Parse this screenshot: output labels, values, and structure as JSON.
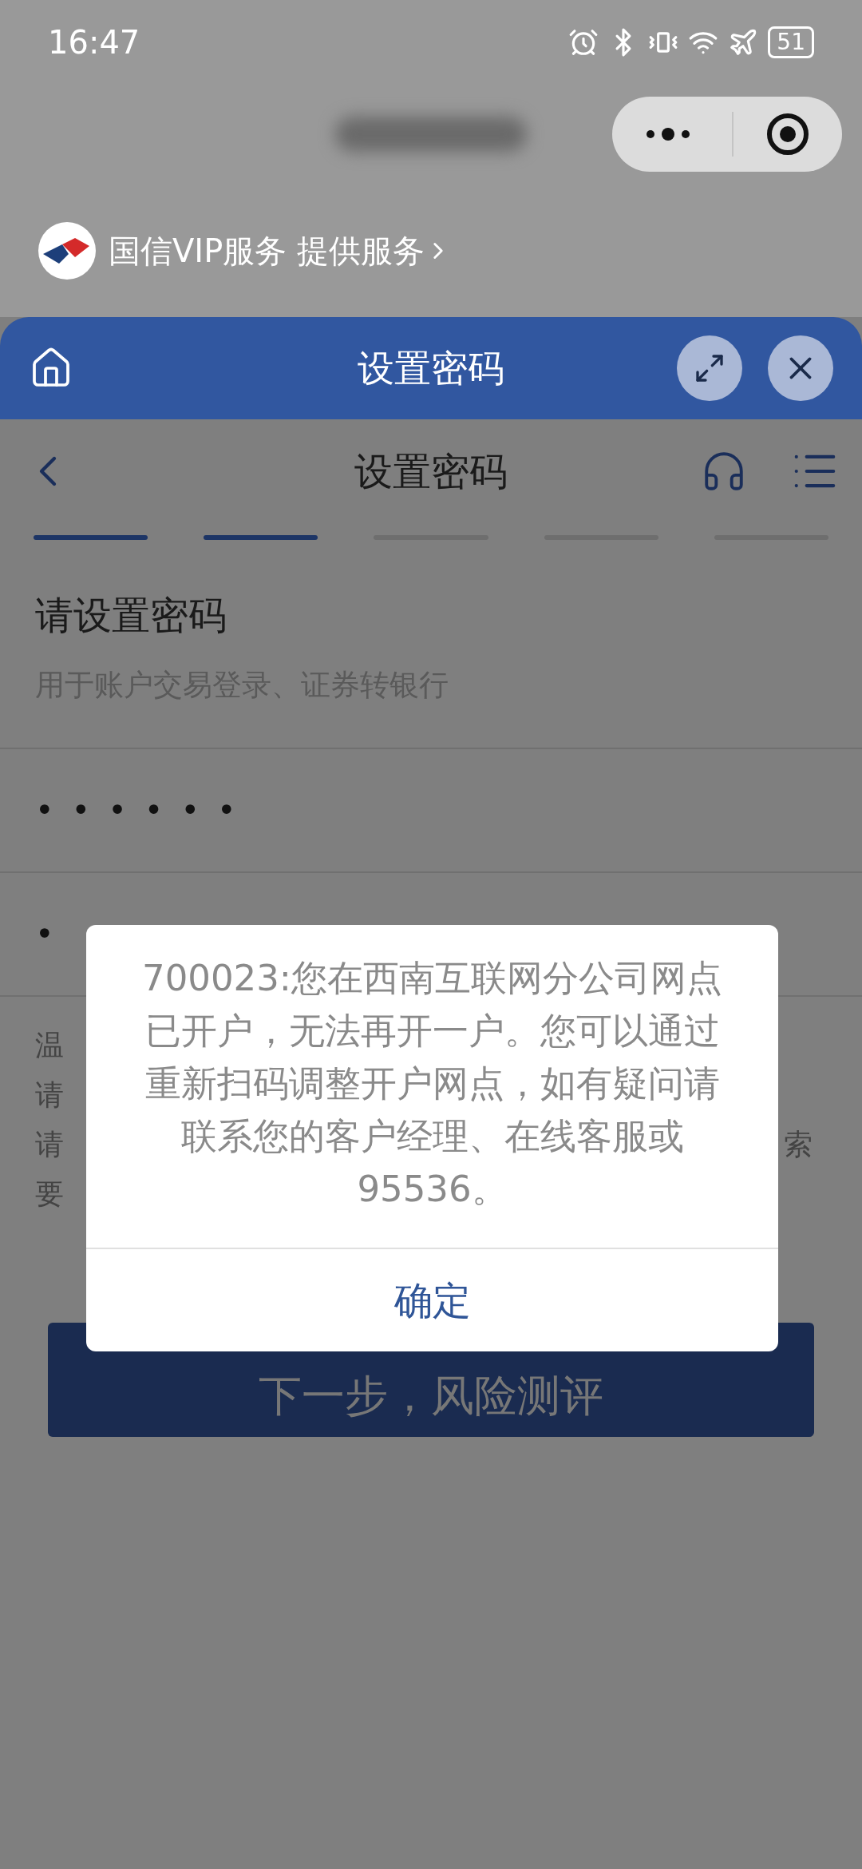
{
  "status_bar": {
    "time": "16:47",
    "battery": "51"
  },
  "provider": {
    "label": "国信VIP服务 提供服务"
  },
  "app_bar": {
    "title": "设置密码"
  },
  "nav_bar": {
    "title": "设置密码"
  },
  "steps": [
    {
      "done": true
    },
    {
      "done": true
    },
    {
      "done": false
    },
    {
      "done": false
    },
    {
      "done": false
    }
  ],
  "section": {
    "title": "请设置密码",
    "subtitle": "用于账户交易登录、证券转银行"
  },
  "fields": [
    {
      "value": "••••••"
    },
    {
      "value": "•"
    }
  ],
  "notice": {
    "left_lines": [
      "温",
      "请",
      "请",
      "要"
    ],
    "right_text": "索"
  },
  "next_button": {
    "label": "下一步，风险测评"
  },
  "dialog": {
    "message": "700023:您在西南互联网分公司网点已开户，无法再开一户。您可以通过重新扫码调整开户网点，如有疑问请联系您的客户经理、在线客服或95536。",
    "confirm": "确定"
  }
}
